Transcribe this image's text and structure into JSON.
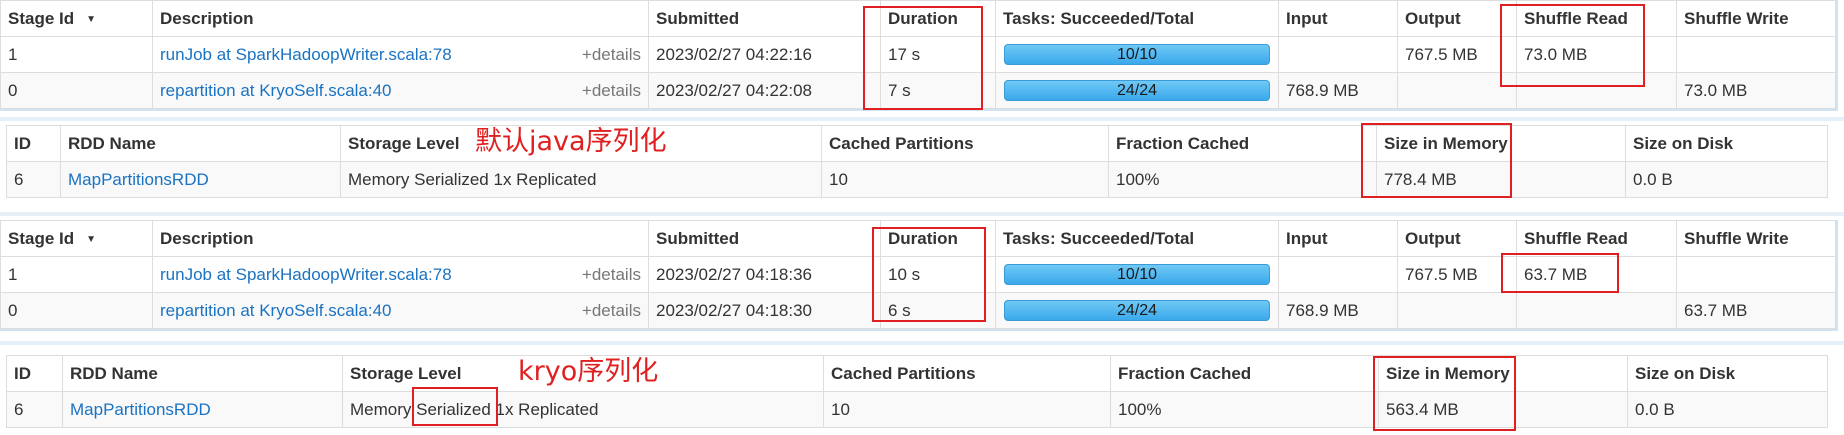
{
  "stage_header": {
    "stage_id": "Stage Id",
    "description": "Description",
    "submitted": "Submitted",
    "duration": "Duration",
    "tasks": "Tasks: Succeeded/Total",
    "input": "Input",
    "output": "Output",
    "shuffle_read": "Shuffle Read",
    "shuffle_write": "Shuffle Write",
    "sort_caret": "▼"
  },
  "storage_header": {
    "id": "ID",
    "rdd_name": "RDD Name",
    "storage_level": "Storage Level",
    "cached_partitions": "Cached Partitions",
    "fraction_cached": "Fraction Cached",
    "size_in_memory": "Size in Memory",
    "size_on_disk": "Size on Disk"
  },
  "details_label": "+details",
  "stages_java": [
    {
      "id": "1",
      "description": "runJob at SparkHadoopWriter.scala:78",
      "submitted": "2023/02/27 04:22:16",
      "duration": "17 s",
      "tasks": "10/10",
      "tasks_fraction": 1.0,
      "input": "",
      "output": "767.5 MB",
      "shuffle_read": "73.0 MB",
      "shuffle_write": ""
    },
    {
      "id": "0",
      "description": "repartition at KryoSelf.scala:40",
      "submitted": "2023/02/27 04:22:08",
      "duration": "7 s",
      "tasks": "24/24",
      "tasks_fraction": 1.0,
      "input": "768.9 MB",
      "output": "",
      "shuffle_read": "",
      "shuffle_write": "73.0 MB"
    }
  ],
  "storage_java": {
    "id": "6",
    "rdd_name": "MapPartitionsRDD",
    "storage_level": "Memory Serialized 1x Replicated",
    "cached_partitions": "10",
    "fraction_cached": "100%",
    "size_in_memory": "778.4 MB",
    "size_on_disk": "0.0 B"
  },
  "stages_kryo": [
    {
      "id": "1",
      "description": "runJob at SparkHadoopWriter.scala:78",
      "submitted": "2023/02/27 04:18:36",
      "duration": "10 s",
      "tasks": "10/10",
      "tasks_fraction": 1.0,
      "input": "",
      "output": "767.5 MB",
      "shuffle_read": "63.7 MB",
      "shuffle_write": ""
    },
    {
      "id": "0",
      "description": "repartition at KryoSelf.scala:40",
      "submitted": "2023/02/27 04:18:30",
      "duration": "6 s",
      "tasks": "24/24",
      "tasks_fraction": 1.0,
      "input": "768.9 MB",
      "output": "",
      "shuffle_read": "",
      "shuffle_write": "63.7 MB"
    }
  ],
  "storage_kryo": {
    "id": "6",
    "rdd_name": "MapPartitionsRDD",
    "storage_level_prefix": "Memory ",
    "storage_level_highlight": "Serialized",
    "storage_level_suffix": " 1x Replicated",
    "cached_partitions": "10",
    "fraction_cached": "100%",
    "size_in_memory": "563.4 MB",
    "size_on_disk": "0.0 B"
  },
  "annotations": {
    "java_label": "默认java序列化",
    "kryo_label": "kryo序列化"
  },
  "annotation_color": "#e02020"
}
